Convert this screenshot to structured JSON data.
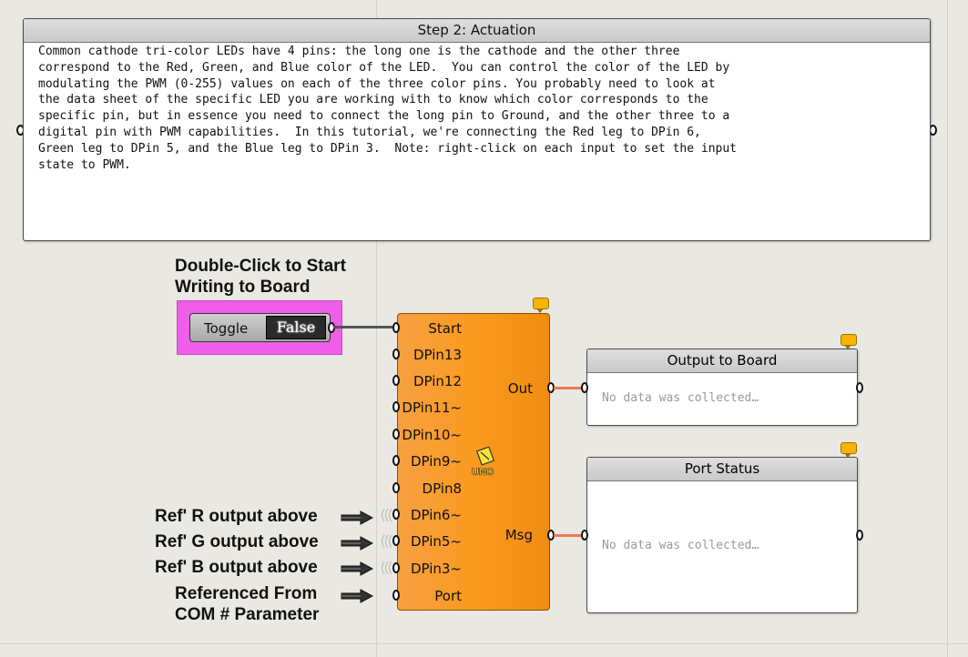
{
  "panel": {
    "title": "Step 2: Actuation",
    "lines": [
      "Common cathode tri-color LEDs have 4 pins: the long one is the cathode and the other three",
      "correspond to the Red, Green, and Blue color of the LED.  You can control the color of the LED by",
      "modulating the PWM (0-255) values on each of the three color pins. You probably need to look at",
      "the data sheet of the specific LED you are working with to know which color corresponds to the",
      "specific pin, but in essence you need to connect the long pin to Ground, and the other three to a",
      "digital pin with PWM capabilities.  In this tutorial, we're connecting the Red leg to DPin 6,",
      "Green leg to DPin 5, and the Blue leg to DPin 3.  Note: right-click on each input to set the input",
      "state to PWM."
    ]
  },
  "labels": {
    "start_line1": "Double-Click to Start",
    "start_line2": "Writing to Board",
    "ref_r": "Ref' R output above",
    "ref_g": "Ref' G output above",
    "ref_b": "Ref' B output above",
    "com_line1": "Referenced From",
    "com_line2": "COM # Parameter"
  },
  "toggle": {
    "label": "Toggle",
    "value": "False"
  },
  "uno": {
    "inputs": [
      "Start",
      "DPin13",
      "DPin12",
      "DPin11~",
      "DPin10~",
      "DPin9~",
      "DPin8",
      "DPin6~",
      "DPin5~",
      "DPin3~",
      "Port"
    ],
    "outputs": [
      "Out",
      "Msg"
    ],
    "logo_text": "UNO"
  },
  "output_panel": {
    "title": "Output to Board",
    "body": "No data was collected…"
  },
  "status_panel": {
    "title": "Port Status",
    "body": "No data was collected…"
  },
  "colors": {
    "component": "#fb9a1f",
    "toggle_bg": "#ee5ee8",
    "wire_out": "#f07a4a",
    "wire_in": "#555555",
    "bubble": "#f7b500"
  }
}
